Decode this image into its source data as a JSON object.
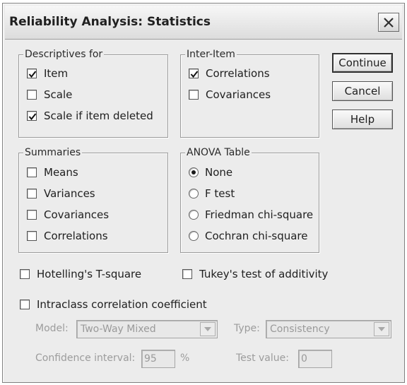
{
  "window": {
    "title": "Reliability Analysis: Statistics"
  },
  "descriptives": {
    "legend": "Descriptives for",
    "items": [
      {
        "label": "Item",
        "checked": true
      },
      {
        "label": "Scale",
        "checked": false
      },
      {
        "label": "Scale if item deleted",
        "checked": true
      }
    ]
  },
  "inter_item": {
    "legend": "Inter-Item",
    "items": [
      {
        "label": "Correlations",
        "checked": true
      },
      {
        "label": "Covariances",
        "checked": false
      }
    ]
  },
  "summaries": {
    "legend": "Summaries",
    "items": [
      {
        "label": "Means",
        "checked": false
      },
      {
        "label": "Variances",
        "checked": false
      },
      {
        "label": "Covariances",
        "checked": false
      },
      {
        "label": "Correlations",
        "checked": false
      }
    ]
  },
  "anova": {
    "legend": "ANOVA Table",
    "options": [
      {
        "label": "None",
        "selected": true
      },
      {
        "label": "F test",
        "selected": false
      },
      {
        "label": "Friedman chi-square",
        "selected": false
      },
      {
        "label": "Cochran chi-square",
        "selected": false
      }
    ]
  },
  "buttons": {
    "continue": "Continue",
    "cancel": "Cancel",
    "help": "Help"
  },
  "options": {
    "hotelling": {
      "label": "Hotelling's T-square",
      "checked": false
    },
    "tukey": {
      "label": "Tukey's test of additivity",
      "checked": false
    },
    "intraclass": {
      "label": "Intraclass correlation coefficient",
      "checked": false
    }
  },
  "icc": {
    "model_label": "Model:",
    "model_value": "Two-Way Mixed",
    "type_label": "Type:",
    "type_value": "Consistency",
    "ci_label": "Confidence interval:",
    "ci_value": "95",
    "ci_unit": "%",
    "test_label": "Test value:",
    "test_value": "0"
  },
  "icons": {
    "close": "close-icon",
    "check": "check-mark-icon",
    "dropdown": "chevron-down-icon"
  }
}
